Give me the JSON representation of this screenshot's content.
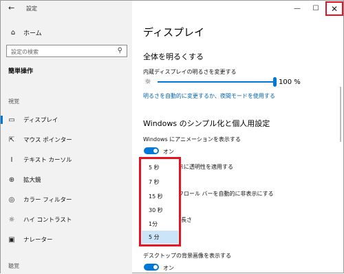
{
  "window": {
    "title": "設定",
    "back_glyph": "←",
    "minimize_glyph": "—",
    "maximize_glyph": "☐",
    "close_glyph": "✕"
  },
  "sidebar": {
    "home": "ホーム",
    "home_glyph": "⌂",
    "search_placeholder": "設定の検索",
    "search_glyph": "⚲",
    "section_easy": "簡単操作",
    "section_vision": "視覚",
    "section_hearing": "聴覚",
    "items": [
      {
        "label": "ディスプレイ",
        "glyph": "▭"
      },
      {
        "label": "マウス ポインター",
        "glyph": "⇱"
      },
      {
        "label": "テキスト カーソル",
        "glyph": "I"
      },
      {
        "label": "拡大鏡",
        "glyph": "⊕"
      },
      {
        "label": "カラー フィルター",
        "glyph": "◎"
      },
      {
        "label": "ハイ コントラスト",
        "glyph": "☼"
      },
      {
        "label": "ナレーター",
        "glyph": "▣"
      }
    ],
    "selected_index": 0
  },
  "main": {
    "title": "ディスプレイ",
    "brightness_heading": "全体を明るくする",
    "brightness_label": "内蔵ディスプレイの明るさを変更する",
    "sun_glyph": "☼",
    "brightness_value": "100 %",
    "brightness_level": 1.0,
    "brightness_link": "明るさを自動的に変更するか、夜間モードを使用する",
    "simplify_heading": "Windows のシンプル化と個人用設定",
    "animation_label": "Windows にアニメーションを表示する",
    "toggle_on": "オン",
    "transparency_partial": "示に透明性を適用する",
    "scrollbar_partial": "クロール バーを自動的に非表示にする",
    "length_partial": "長さ",
    "background_label": "デスクトップの背景画像を表示する"
  },
  "dropdown": {
    "options": [
      "5 秒",
      "7 秒",
      "15 秒",
      "30 秒",
      "1分",
      "5 分"
    ],
    "selected_index": 5
  },
  "colors": {
    "accent": "#0078d7",
    "highlight": "#e81123",
    "selected_option": "#cce4f7",
    "sidebar_bg": "#f2f2f2"
  }
}
